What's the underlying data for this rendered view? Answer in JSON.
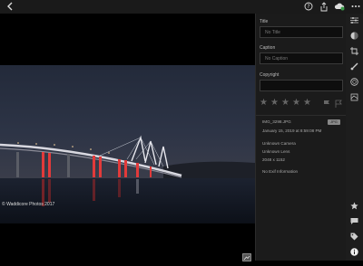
{
  "topbar": {
    "icons": [
      "back-icon",
      "help-icon",
      "share-icon",
      "cloud-sync-icon",
      "more-icon"
    ]
  },
  "photo": {
    "copyright": "© Waddicore Photos 2017"
  },
  "info_panel": {
    "title_label": "Title",
    "title_placeholder": "No Title",
    "caption_label": "Caption",
    "caption_placeholder": "No Caption",
    "copyright_label": "Copyright",
    "copyright_value": "",
    "rating": 0,
    "file_name": "IMG_3298.JPG",
    "file_type": "JPG",
    "date": "January 15, 2019 at 8:59:08 PM",
    "camera": "Unknown Camera",
    "lens": "Unknown Lens",
    "dimensions": "2048 x 1152",
    "exif": "No Exif Information"
  },
  "right_toolbar": {
    "icons": [
      "edit-sliders-icon",
      "color-icon",
      "crop-icon",
      "brush-icon",
      "radial-icon",
      "selective-icon",
      "star-icon",
      "comment-icon",
      "tag-icon",
      "info-icon"
    ]
  }
}
